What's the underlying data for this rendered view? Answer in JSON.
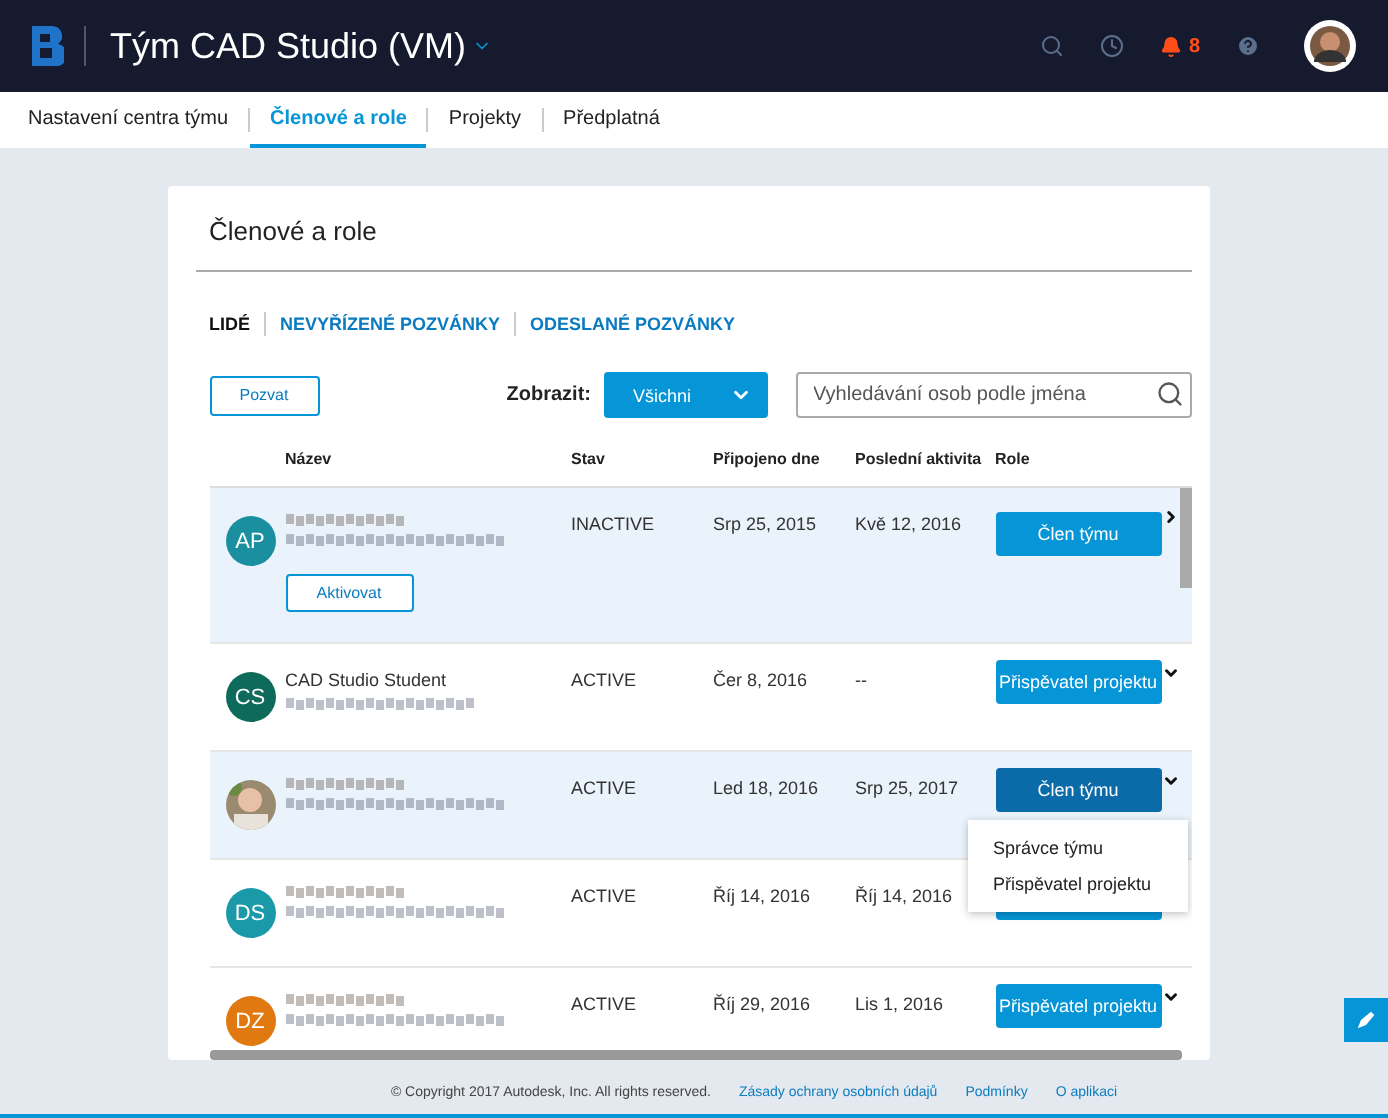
{
  "header": {
    "title": "Tým CAD Studio (VM)",
    "notifications": "8"
  },
  "nav_tabs": [
    {
      "label": "Nastavení centra týmu",
      "selected": false
    },
    {
      "label": "Členové a role",
      "selected": true
    },
    {
      "label": "Projekty",
      "selected": false
    },
    {
      "label": "Předplatná",
      "selected": false
    }
  ],
  "card": {
    "title": "Členové a role",
    "sub_tabs": [
      {
        "label": "LIDÉ",
        "selected": true
      },
      {
        "label": "NEVYŘÍZENÉ POZVÁNKY",
        "selected": false
      },
      {
        "label": "ODESLANÉ POZVÁNKY",
        "selected": false
      }
    ],
    "invite_button": "Pozvat",
    "filter_label": "Zobrazit:",
    "filter_value": "Všichni",
    "search": {
      "placeholder": "Vyhledávání osob podle jména"
    },
    "table": {
      "columns": [
        "Název",
        "Stav",
        "Připojeno dne",
        "Poslední aktivita",
        "Role"
      ],
      "rows": [
        {
          "avatar": {
            "kind": "initials",
            "initials": "AP",
            "color": "#1a8fa0"
          },
          "status": "INACTIVE",
          "joined": "Srp 25, 2015",
          "last_activity": "Kvě 12, 2016",
          "role": "Člen týmu",
          "collapsed": true,
          "highlighted": true,
          "action": "Aktivovat"
        },
        {
          "avatar": {
            "kind": "initials",
            "initials": "CS",
            "color": "#0e6b5c"
          },
          "name": "CAD Studio Student",
          "status": "ACTIVE",
          "joined": "Čer 8, 2016",
          "last_activity": "--",
          "role": "Přispěvatel projektu",
          "collapsed": false,
          "highlighted": false
        },
        {
          "avatar": {
            "kind": "picture"
          },
          "status": "ACTIVE",
          "joined": "Led 18, 2016",
          "last_activity": "Srp 25, 2017",
          "role": "Člen týmu",
          "collapsed": false,
          "highlighted": true,
          "menu": [
            "Správce týmu",
            "Přispěvatel projektu"
          ]
        },
        {
          "avatar": {
            "kind": "initials",
            "initials": "DS",
            "color": "#1a9aa8"
          },
          "status": "ACTIVE",
          "joined": "Říj 14, 2016",
          "last_activity": "Říj 14, 2016",
          "highlighted": false
        },
        {
          "avatar": {
            "kind": "initials",
            "initials": "DZ",
            "color": "#e07a10"
          },
          "status": "ACTIVE",
          "joined": "Říj 29, 2016",
          "last_activity": "Lis 1, 2016",
          "role": "Přispěvatel projektu",
          "collapsed": false,
          "highlighted": false
        }
      ]
    }
  },
  "footer": {
    "copyright": "© Copyright 2017 Autodesk, Inc. All rights reserved.",
    "links": [
      "Zásady ochrany osobních údajů",
      "Podmínky",
      "O aplikaci"
    ]
  }
}
